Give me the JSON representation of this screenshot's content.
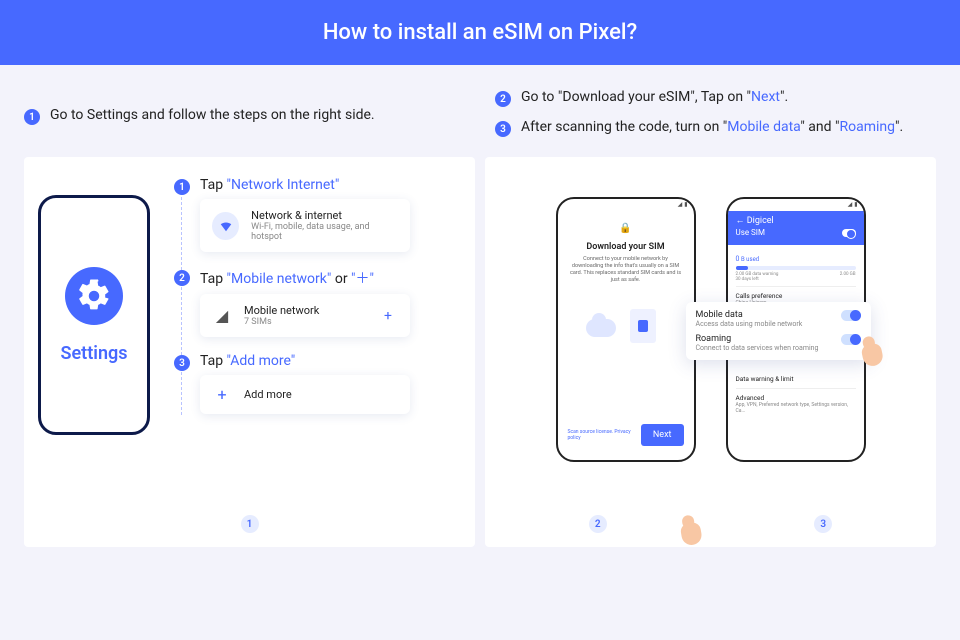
{
  "header": {
    "title": "How to install an eSIM on Pixel?"
  },
  "intro": {
    "left": {
      "num": "1",
      "text_a": "Go to Settings and follow the steps on the right side."
    },
    "right": [
      {
        "num": "2",
        "pre": "Go to \"Download your eSIM\", Tap on \"",
        "hl": "Next",
        "post": "\"."
      },
      {
        "num": "3",
        "pre": "After scanning the code, turn on \"",
        "hl1": "Mobile data",
        "mid": "\" and \"",
        "hl2": "Roaming",
        "post": "\"."
      }
    ]
  },
  "left_panel": {
    "settings_label": "Settings",
    "steps": [
      {
        "num": "1",
        "pre": "Tap ",
        "hl": "\"Network Internet\"",
        "card": {
          "title": "Network & internet",
          "sub": "Wi-Fi, mobile, data usage, and hotspot"
        }
      },
      {
        "num": "2",
        "pre": "Tap ",
        "hl": "\"Mobile network\"",
        "mid": " or ",
        "hl2": "\"＋\"",
        "card": {
          "title": "Mobile network",
          "sub": "7 SIMs",
          "plus": "+"
        }
      },
      {
        "num": "3",
        "pre": "Tap ",
        "hl": "\"Add more\"",
        "card": {
          "title": "Add more",
          "plus_left": "+"
        }
      }
    ],
    "footer_num": "1"
  },
  "right_panel": {
    "phone_download": {
      "title": "Download your SIM",
      "desc": "Connect to your mobile network by downloading the info that's usually on a SIM card. This replaces standard SIM cards and is just as safe.",
      "footer_link": "Scan source license. Privacy policy",
      "next_label": "Next"
    },
    "phone_toggles": {
      "carrier": "Digicel",
      "use_sim": "Use SIM",
      "used_label": "B used",
      "used_val": "0",
      "warn": "2.00 GB data warning",
      "days": "30 days left",
      "limit": "2.00 GB",
      "rows": [
        {
          "t": "Calls preference",
          "s": "China Unicom"
        },
        {
          "t": "Data warning & limit",
          "s": ""
        },
        {
          "t": "Advanced",
          "s": "App, VPN, Preferred network type, Settings version, Ca..."
        }
      ]
    },
    "overlay": {
      "mobile_t": "Mobile data",
      "mobile_s": "Access data using mobile network",
      "roam_t": "Roaming",
      "roam_s": "Connect to data services when roaming"
    },
    "footer_nums": [
      "2",
      "3"
    ]
  }
}
